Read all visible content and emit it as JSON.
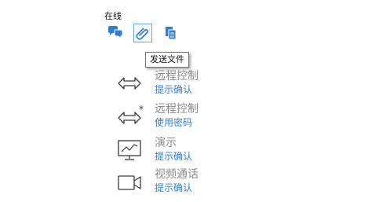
{
  "status": {
    "label": "在线"
  },
  "toolbar": {
    "buttons": [
      {
        "icon": "chat-icon"
      },
      {
        "icon": "paperclip-icon",
        "active": true
      },
      {
        "icon": "copy-icon"
      }
    ]
  },
  "tooltip": {
    "text": "发送文件"
  },
  "actions": [
    {
      "icon": "remote-control-arrows-icon",
      "title": "远程控制",
      "subtitle": "提示确认"
    },
    {
      "icon": "remote-control-password-icon",
      "title": "远程控制",
      "subtitle": "使用密码"
    },
    {
      "icon": "monitor-chart-icon",
      "title": "演示",
      "subtitle": "提示确认"
    },
    {
      "icon": "video-camera-icon",
      "title": "视频通话",
      "subtitle": "提示确认"
    }
  ],
  "colors": {
    "accent": "#2f7fd0",
    "muted_text": "#8a8a8a",
    "icon_gray": "#3a3a3a"
  }
}
